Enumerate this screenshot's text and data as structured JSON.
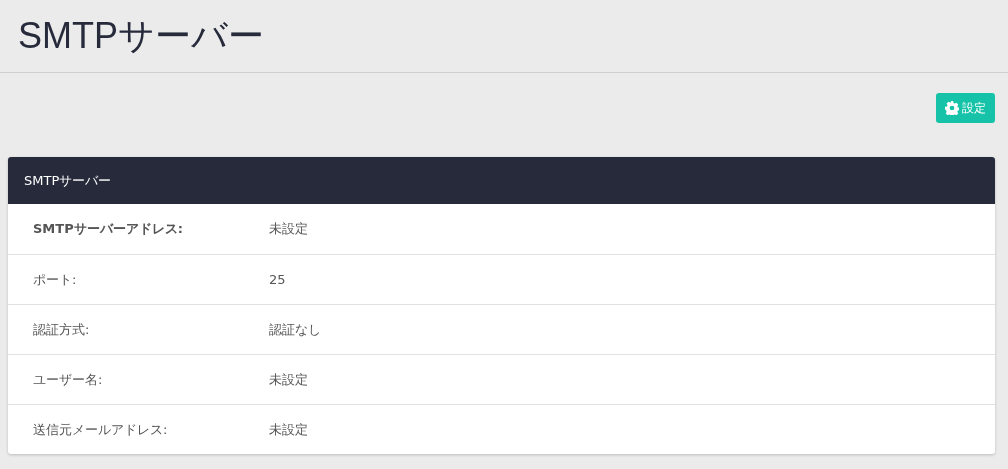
{
  "page_title": "SMTPサーバー",
  "settings_button": {
    "label": "設定"
  },
  "panel": {
    "title": "SMTPサーバー",
    "rows": [
      {
        "label": "SMTPサーバーアドレス:",
        "value": "未設定",
        "bold": true
      },
      {
        "label": "ポート:",
        "value": "25",
        "bold": false
      },
      {
        "label": "認証方式:",
        "value": "認証なし",
        "bold": false
      },
      {
        "label": "ユーザー名:",
        "value": "未設定",
        "bold": false
      },
      {
        "label": "送信元メールアドレス:",
        "value": "未設定",
        "bold": false
      }
    ]
  }
}
